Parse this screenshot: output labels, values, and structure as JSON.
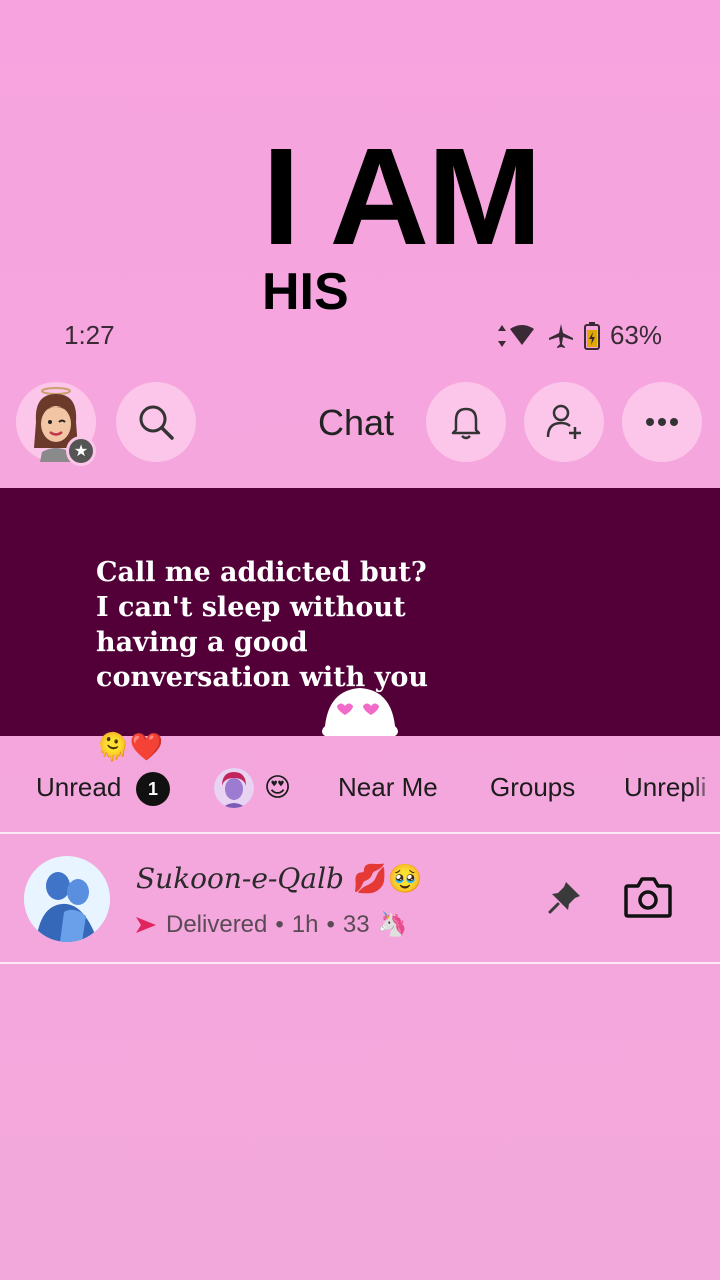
{
  "overlay": {
    "line1": "I AM",
    "line2": "HIS"
  },
  "status_bar": {
    "time": "1:27",
    "battery": "63%"
  },
  "header": {
    "title": "Chat",
    "icons": [
      "avatar",
      "search-icon",
      "bell-icon",
      "add-friend-icon",
      "more-icon"
    ]
  },
  "banner": {
    "text": "Call me addicted but?\nI can't sleep without\nhaving a good\nconversation with you",
    "emoji": "🫠❤️"
  },
  "filters": {
    "unread_label": "Unread",
    "unread_count": "1",
    "emoji_tab": "😍",
    "near_me": "Near Me",
    "groups": "Groups",
    "unreplied": "Unrepli"
  },
  "chat_row": {
    "name": "Sukoon-e-Qalb",
    "name_emoji": "💋🥹",
    "status": "Delivered",
    "time": "1h",
    "streak": "33",
    "streak_emoji": "🦄"
  },
  "colors": {
    "background": "#f5a6dd",
    "banner": "#530038",
    "accent": "#e0245e"
  }
}
